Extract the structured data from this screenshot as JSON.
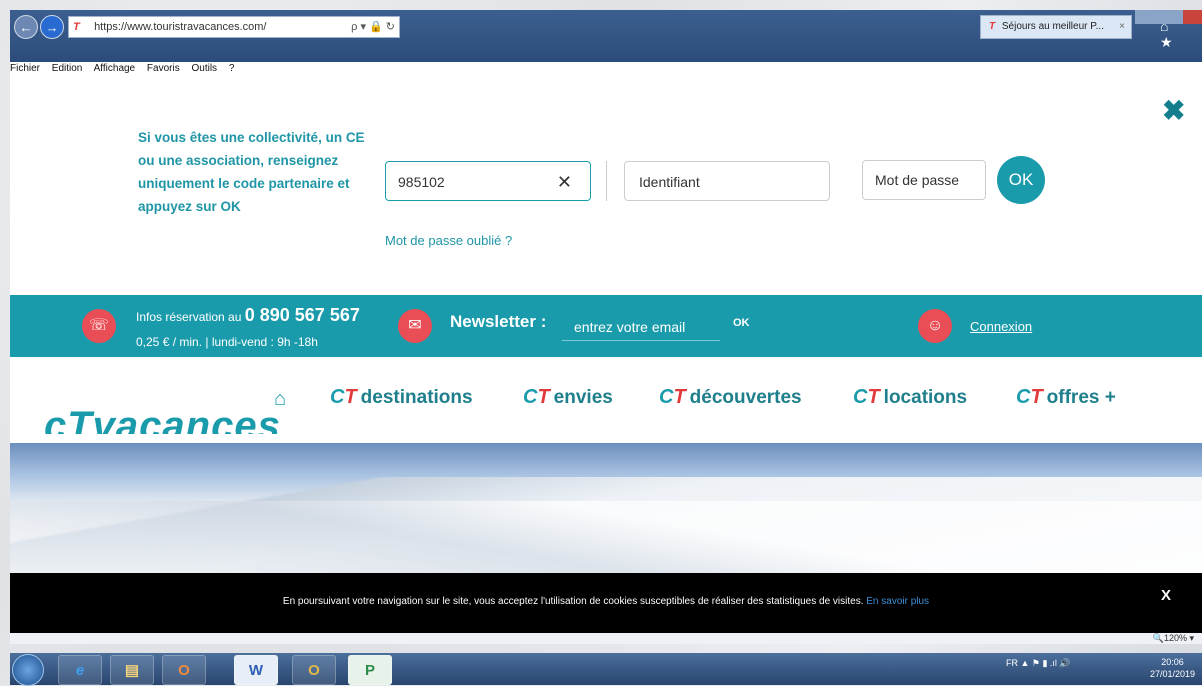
{
  "browser": {
    "url": "https://www.touristravacances.com/",
    "addr_controls": "ρ ▾ 🔒 ↻",
    "tab_title": "Séjours au meilleur P...",
    "tab_close": "×",
    "home_star": "⌂ ★",
    "menu": [
      "Fichier",
      "Edition",
      "Affichage",
      "Favoris",
      "Outils",
      "?"
    ]
  },
  "login_panel": {
    "ce_text": "Si vous êtes une collectivité, un CE ou une association, renseignez uniquement le code partenaire et appuyez sur OK",
    "code_value": "985102",
    "clear_symbol": "✕",
    "id_placeholder": "Identifiant",
    "password_placeholder": "Mot de passe",
    "ok_label": "OK",
    "forgot_label": "Mot de passe oublié ?",
    "close_symbol": "✖"
  },
  "info_bar": {
    "phone_prefix": "Infos réservation au ",
    "phone_number": "0 890 567 567",
    "phone_details": "0,25 € / min. | lundi-vend : 9h -18h",
    "newsletter_label": "Newsletter :",
    "newsletter_placeholder": "entrez votre email",
    "newsletter_ok": "OK",
    "login_link": "Connexion",
    "colors": {
      "teal": "#1a9bab",
      "red": "#e94d55"
    }
  },
  "nav": {
    "logo": "cTvacances",
    "items": [
      {
        "brand": "CT",
        "label": "destinations"
      },
      {
        "brand": "CT",
        "label": "envies"
      },
      {
        "brand": "CT",
        "label": "découvertes"
      },
      {
        "brand": "CT",
        "label": "locations"
      },
      {
        "brand": "CT",
        "label": "offres +"
      }
    ]
  },
  "cookie_banner": {
    "text": "En poursuivant votre navigation sur le site, vous acceptez l'utilisation de cookies susceptibles de réaliser des statistiques de visites.",
    "more_link": "En savoir plus",
    "close_label": "X"
  },
  "status_bar": {
    "zoom": "🔍120% ▾"
  },
  "taskbar": {
    "apps": [
      "e",
      "▤",
      "O",
      "W",
      "O",
      "P"
    ],
    "tray": "FR ▲ ⚑ ▮ .ıl 🔊",
    "time": "20:06",
    "date": "27/01/2019"
  }
}
